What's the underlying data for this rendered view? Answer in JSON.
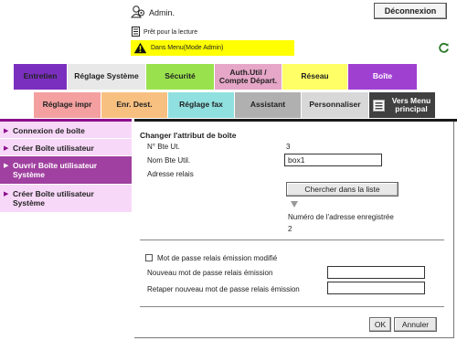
{
  "header": {
    "admin_label": "Admin.",
    "logout_label": "Déconnexion",
    "status_text": "Prêt pour la lecture",
    "warning_text": "Dans Menu(Mode Admin)"
  },
  "tabs_row1": [
    {
      "label": "Entretien",
      "color": "#7b2fbf",
      "selected": false
    },
    {
      "label": "Réglage Système",
      "color": "#e8e8e8",
      "selected": false
    },
    {
      "label": "Sécurité",
      "color": "#99e24e",
      "selected": false
    },
    {
      "label": "Auth.Util / Compte Départ.",
      "color": "#e6a6c8",
      "selected": false
    },
    {
      "label": "Réseau",
      "color": "#ffff66",
      "selected": false
    },
    {
      "label": "Boîte",
      "color": "#a040d0",
      "selected": true
    }
  ],
  "tabs_row2": [
    {
      "label": "Réglage impr",
      "color": "#f4a0a0"
    },
    {
      "label": "Enr. Dest.",
      "color": "#f8c080"
    },
    {
      "label": "Réglage fax",
      "color": "#90e0e0"
    },
    {
      "label": "Assistant",
      "color": "#b0b0b0"
    },
    {
      "label": "Personnaliser",
      "color": "#d8d8d8"
    },
    {
      "label": "Vers Menu principal",
      "color": "#404040"
    }
  ],
  "sidebar": {
    "items": [
      {
        "label": "Connexion de boîte",
        "selected": false
      },
      {
        "label": "Créer Boîte utilisateur",
        "selected": false
      },
      {
        "label": "Ouvrir Boîte utilisateur Système",
        "selected": true
      },
      {
        "label": "Créer Boîte utilisateur Système",
        "selected": false
      }
    ]
  },
  "form": {
    "title": "Changer l'attribut de boîte",
    "box_number_label": "N° Bte Ut.",
    "box_number_value": "3",
    "box_name_label": "Nom Bte Util.",
    "box_name_value": "box1",
    "relay_address_label": "Adresse relais",
    "search_button": "Chercher dans la liste",
    "registered_number_label": "Numéro de l'adresse enregistrée",
    "registered_number_value": "2",
    "password_modified_label": "Mot de passe relais émission modifié",
    "new_password_label": "Nouveau mot de passe relais émission",
    "new_password_value": "",
    "retype_password_label": "Retaper nouveau mot de passe relais émission",
    "retype_password_value": "",
    "ok_button": "OK",
    "cancel_button": "Annuler"
  }
}
